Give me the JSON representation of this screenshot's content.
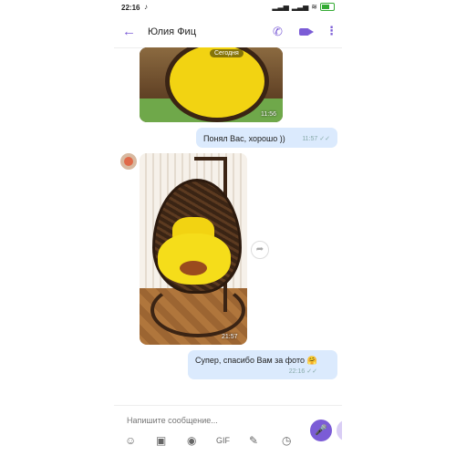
{
  "status_bar": {
    "time": "22:16",
    "tiktok_icon": "tiktok-icon",
    "battery_color": "#33aa33"
  },
  "header": {
    "contact_name": "Юлия Фиц",
    "accent_color": "#7b5cd6",
    "icons": {
      "back": "arrow-left-icon",
      "call": "phone-icon",
      "video": "video-camera-icon",
      "more": "more-vert-icon"
    }
  },
  "messages": [
    {
      "type": "photo",
      "direction": "in",
      "date_pill": "Сегодня",
      "time": "11:56"
    },
    {
      "type": "text",
      "direction": "out",
      "text": "Понял Вас, хорошо ))",
      "time": "11:57"
    },
    {
      "type": "photo",
      "direction": "in",
      "time": "21:57"
    },
    {
      "type": "text",
      "direction": "out",
      "text": "Супер, спасибо Вам за фото 🤗",
      "time": "22:16"
    }
  ],
  "composer": {
    "placeholder": "Напишите сообщение...",
    "tools": [
      "sticker-icon",
      "image-icon",
      "camera-icon",
      "gif-icon",
      "doodle-icon",
      "timer-icon",
      "more-horiz-icon"
    ]
  },
  "colors": {
    "outgoing_bubble": "#dbeafd",
    "mic_button": "#7b5cd6"
  }
}
